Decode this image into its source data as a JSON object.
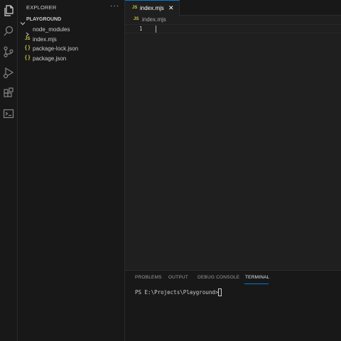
{
  "activity_bar": {
    "icons": [
      "explorer-icon",
      "search-icon",
      "source-control-icon",
      "run-debug-icon",
      "extensions-icon",
      "terminal-icon"
    ],
    "icon_color": "#858585",
    "active_icon_color": "#d7d7d7"
  },
  "sidebar": {
    "title": "EXPLORER",
    "more": "···",
    "folder": "PLAYGROUND",
    "items": [
      {
        "icon": "chevron-right-icon",
        "label": "node_modules"
      },
      {
        "icon": "JS",
        "label": "index.mjs"
      },
      {
        "icon": "{ }",
        "label": "package-lock.json"
      },
      {
        "icon": "{ }",
        "label": "package.json"
      }
    ]
  },
  "editor": {
    "tab": {
      "icon": "JS",
      "label": "index.mjs",
      "close": "✕"
    },
    "breadcrumb": {
      "icon": "JS",
      "label": "index.mjs"
    },
    "line_number": "1",
    "accent": "#0078d4"
  },
  "panel": {
    "tabs": [
      "PROBLEMS",
      "OUTPUT",
      "DEBUG CONSOLE",
      "TERMINAL"
    ],
    "active_tab": "TERMINAL",
    "terminal_prompt": "PS E:\\Projects\\Playground>"
  }
}
